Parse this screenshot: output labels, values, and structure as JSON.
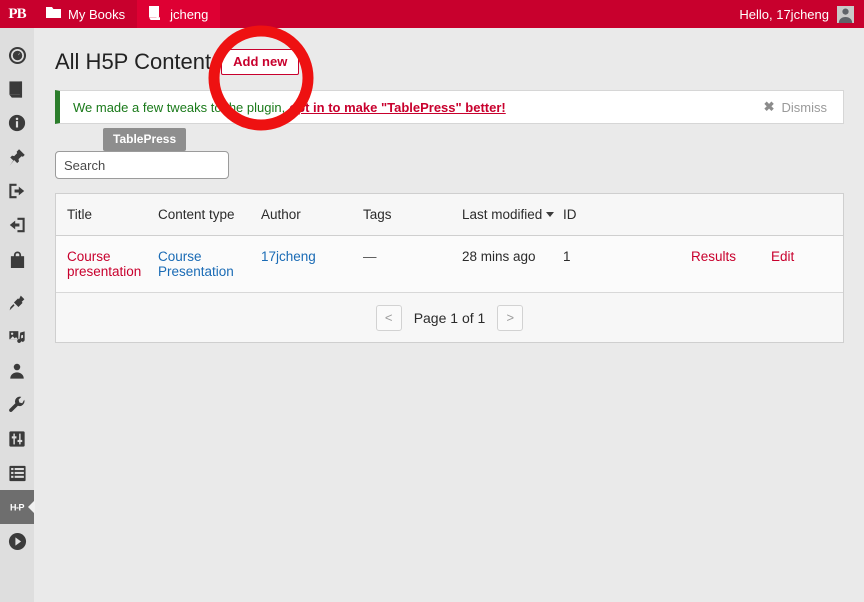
{
  "adminbar": {
    "logo": "PB",
    "items": [
      {
        "label": "My Books",
        "icon": "folder-icon"
      },
      {
        "label": "jcheng",
        "icon": "book-icon"
      }
    ],
    "greeting": "Hello, 17jcheng",
    "avatar_icon": "avatar-icon"
  },
  "sidebar": {
    "items": [
      {
        "name": "dashboard",
        "icon": "dashboard-icon"
      },
      {
        "name": "book",
        "icon": "book-icon"
      },
      {
        "name": "book-info",
        "icon": "info-icon"
      },
      {
        "name": "appearance",
        "icon": "pin-icon"
      },
      {
        "name": "export",
        "icon": "export-icon"
      },
      {
        "name": "import",
        "icon": "import-icon"
      },
      {
        "name": "store",
        "icon": "store-icon"
      },
      {
        "name": "plugins",
        "icon": "plug-icon"
      },
      {
        "name": "media",
        "icon": "media-icon"
      },
      {
        "name": "users",
        "icon": "user-icon"
      },
      {
        "name": "tools",
        "icon": "wrench-icon"
      },
      {
        "name": "settings",
        "icon": "sliders-icon"
      },
      {
        "name": "tablepress",
        "icon": "list-icon"
      },
      {
        "name": "h5p-content",
        "icon": "h5p-icon",
        "label": "H-P",
        "active": true
      },
      {
        "name": "interactive-content",
        "icon": "play-icon"
      }
    ]
  },
  "page": {
    "title": "All H5P Content",
    "add_new_label": "Add new"
  },
  "notice": {
    "text": "We made a few tweaks to the plugin,",
    "link": "opt in to make \"TablePress\" better!",
    "dismiss_label": "Dismiss",
    "dismiss_icon": "close-icon",
    "accent_color": "#2b7d2b"
  },
  "tooltip": {
    "label": "TablePress"
  },
  "search": {
    "value": "",
    "placeholder": "Search"
  },
  "table": {
    "columns": [
      {
        "key": "title",
        "label": "Title"
      },
      {
        "key": "content_type",
        "label": "Content type"
      },
      {
        "key": "author",
        "label": "Author"
      },
      {
        "key": "tags",
        "label": "Tags"
      },
      {
        "key": "last_modified",
        "label": "Last modified",
        "sorted": "desc"
      },
      {
        "key": "id",
        "label": "ID"
      },
      {
        "key": "results",
        "label": ""
      },
      {
        "key": "edit",
        "label": ""
      }
    ],
    "rows": [
      {
        "title": "Course presentation",
        "content_type": "Course Presentation",
        "author": "17jcheng",
        "tags": "—",
        "last_modified": "28 mins ago",
        "id": "1",
        "results": "Results",
        "edit": "Edit"
      }
    ]
  },
  "pagination": {
    "prev_label": "<",
    "next_label": ">",
    "page_label": "Page 1 of 1"
  },
  "annotation": {
    "shape": "circle",
    "color": "#ee1111"
  },
  "colors": {
    "brand_red": "#c8002d",
    "link_blue": "#1a6bb5",
    "notice_green": "#1a7a1a",
    "sidebar_bg": "#dedede",
    "page_bg": "#eaeaea"
  }
}
